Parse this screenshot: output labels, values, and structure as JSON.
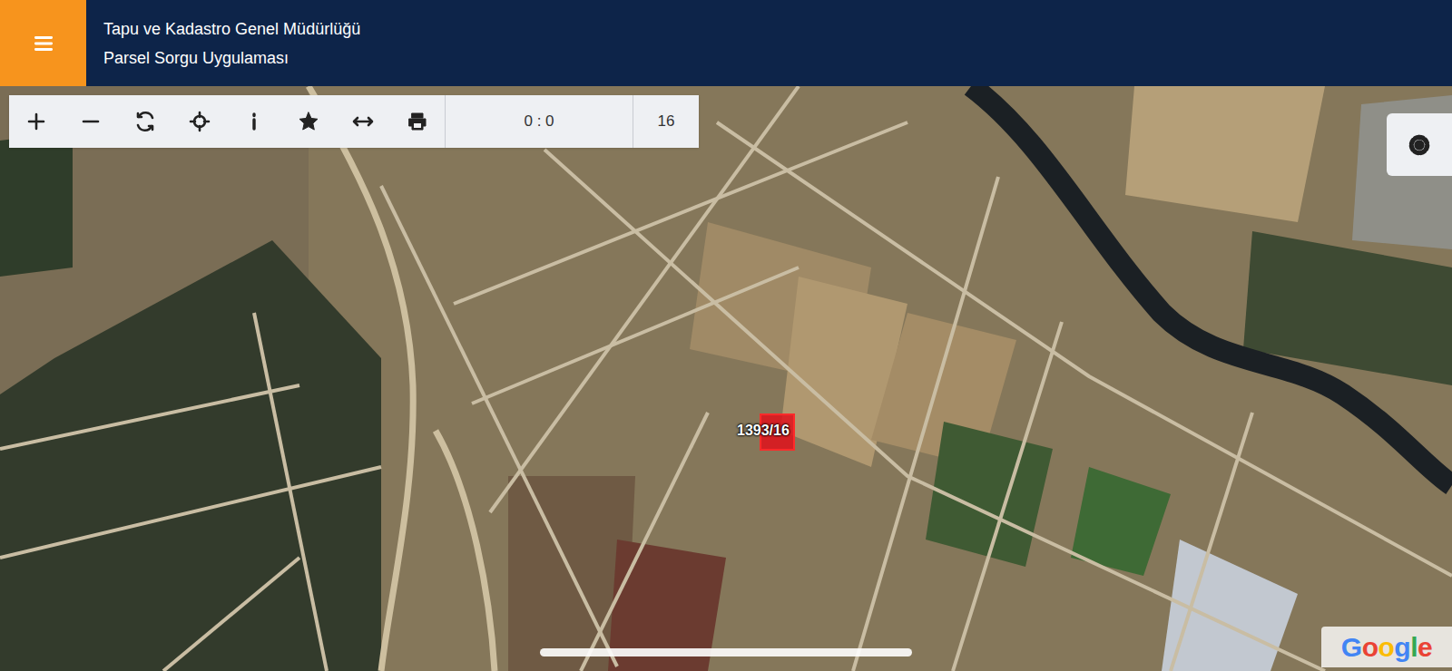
{
  "header": {
    "title": "Tapu ve Kadastro Genel Müdürlüğü",
    "subtitle": "Parsel Sorgu Uygulaması"
  },
  "toolbar": {
    "scale": "0 : 0",
    "zoom": "16"
  },
  "map": {
    "parcel": {
      "label": "1393/16"
    },
    "attribution": "Google"
  }
}
